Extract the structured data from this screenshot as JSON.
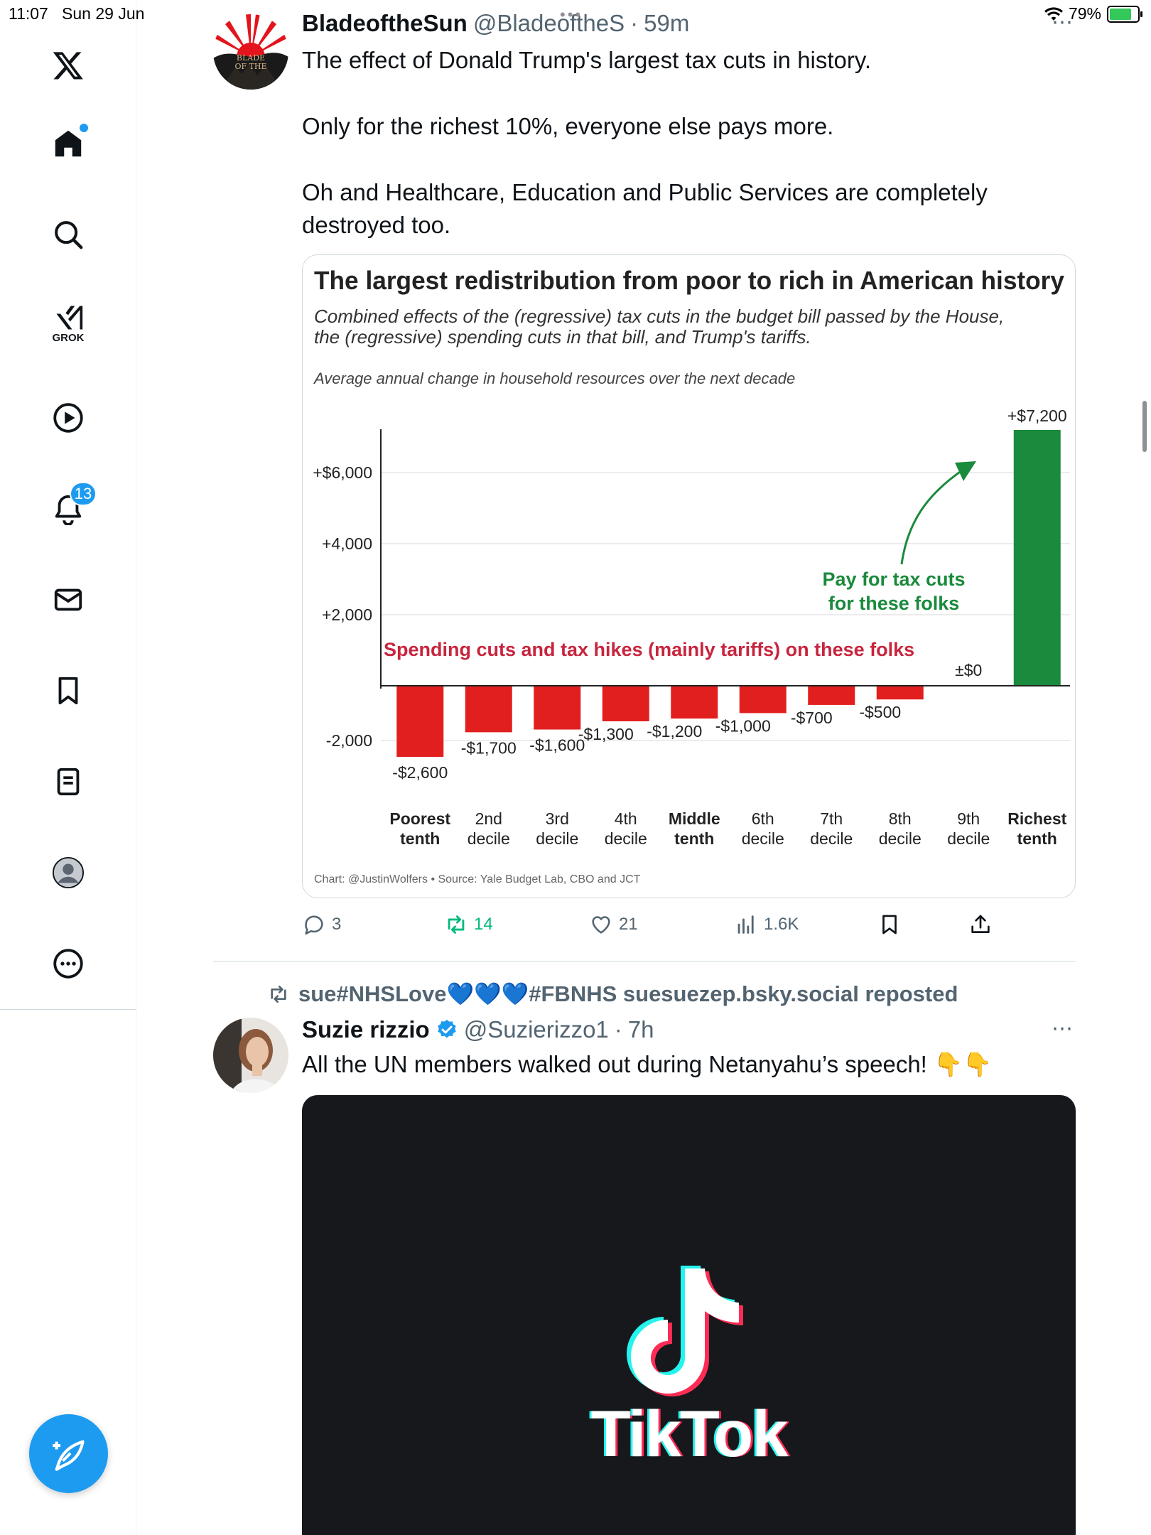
{
  "status_bar": {
    "time": "11:07",
    "date": "Sun 29 Jun",
    "battery": "79%",
    "battery_level": 0.79
  },
  "sidebar": {
    "logo": "x-logo-icon",
    "items": [
      {
        "name": "home",
        "icon": "home-icon"
      },
      {
        "name": "search",
        "icon": "search-icon"
      },
      {
        "name": "grok",
        "icon": "grok-icon",
        "label": "GROK"
      },
      {
        "name": "video",
        "icon": "play-icon"
      },
      {
        "name": "notifications",
        "icon": "bell-icon",
        "badge": "13"
      },
      {
        "name": "messages",
        "icon": "mail-icon"
      },
      {
        "name": "bookmarks",
        "icon": "bookmark-icon"
      },
      {
        "name": "lists",
        "icon": "list-icon"
      },
      {
        "name": "profile",
        "icon": "avatar-icon"
      },
      {
        "name": "more",
        "icon": "more-icon"
      }
    ],
    "compose_icon": "compose-icon"
  },
  "post1": {
    "display_name": "BladeoftheSun",
    "handle": "@BladeoftheS",
    "sep": "·",
    "time": "59m",
    "text1": "The effect of Donald Trump's largest tax cuts in history.",
    "text2": "Only for the richest 10%, everyone else pays more.",
    "text3a": "Oh and Healthcare, Education and Public Services are completely",
    "text3b": "destroyed too.",
    "actions": {
      "replies": "3",
      "reposts": "14",
      "likes": "21",
      "views": "1.6K"
    }
  },
  "chart_data": {
    "type": "bar",
    "title": "The largest redistribution from poor to rich in American history",
    "subtitle_line1": "Combined effects of the (regressive) tax cuts in the budget bill passed by the House,",
    "subtitle_line2": "the (regressive) spending cuts in that bill, and Trump's tariffs.",
    "ylabel": "Average annual change in household resources over the next decade",
    "categories": [
      [
        "Poorest",
        "tenth"
      ],
      [
        "2nd",
        "decile"
      ],
      [
        "3rd",
        "decile"
      ],
      [
        "4th",
        "decile"
      ],
      [
        "Middle",
        "tenth"
      ],
      [
        "6th",
        "decile"
      ],
      [
        "7th",
        "decile"
      ],
      [
        "8th",
        "decile"
      ],
      [
        "9th",
        "decile"
      ],
      [
        "Richest",
        "tenth"
      ]
    ],
    "bold_categories": [
      0,
      4,
      9
    ],
    "values": [
      -2600,
      -1700,
      -1600,
      -1300,
      -1200,
      -1000,
      -700,
      -500,
      0,
      7200
    ],
    "value_labels": [
      "-$2,600",
      "-$1,700",
      "-$1,600",
      "-$1,300",
      "-$1,200",
      "-$1,000",
      "-$700",
      "-$500",
      "±$0",
      "+$7,200"
    ],
    "yticks": [
      -2000,
      2000,
      4000,
      6000
    ],
    "ytick_labels": [
      "-2,000",
      "+2,000",
      "+4,000",
      "+$6,000"
    ],
    "ylim": [
      -2900,
      7200
    ],
    "annotation_red": "Spending cuts and tax hikes (mainly tariffs) on these folks",
    "annotation_green_line1": "Pay for tax cuts",
    "annotation_green_line2": "for these folks",
    "credit": "Chart: @JustinWolfers • Source: Yale Budget Lab, CBO and JCT",
    "colors": {
      "negative": "#e21f1f",
      "positive": "#1a8a3c",
      "annotation_red": "#c8253e",
      "annotation_green": "#1a8a3c"
    }
  },
  "post2": {
    "repost_label": "sue#NHSLove💙💙💙#FBNHS suesuezep.bsky.social reposted",
    "display_name": "Suzie rizzio",
    "handle": "@Suzierizzo1",
    "sep": "·",
    "time": "7h",
    "text": "All the UN members walked out during Netanyahu’s speech! 👇👇",
    "media_text": "TikTok"
  }
}
